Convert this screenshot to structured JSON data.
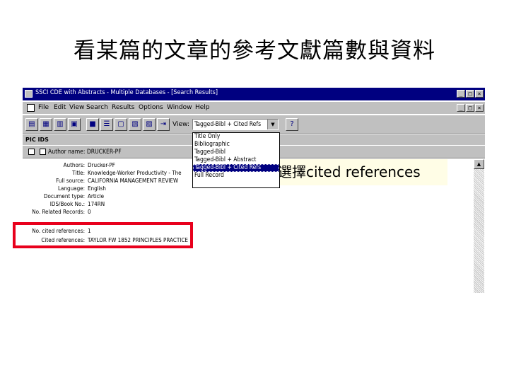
{
  "slide": {
    "title": "看某篇的文章的參考文獻篇數與資料"
  },
  "window": {
    "title": "SSCI CDE with Abstracts - Multiple Databases - [Search Results]",
    "controls": [
      "_",
      "□",
      "×"
    ],
    "doc_controls": [
      "_",
      "□",
      "×"
    ]
  },
  "menu": [
    "File",
    "Edit",
    "View",
    "Search",
    "Results",
    "Options",
    "Window",
    "Help"
  ],
  "toolbar": {
    "view_label": "View:",
    "view_value": "Tagged-Bibl + Cited Refs",
    "buttons": [
      "print-icon",
      "save-icon",
      "export-icon",
      "copy-icon",
      "mark-icon",
      "list-icon",
      "doc-icon",
      "related-icon",
      "cited-icon",
      "first-icon",
      "prev-icon",
      "next-icon",
      "last-icon"
    ],
    "help_glyph": "?"
  },
  "subbar": {
    "text": "PIC IDS"
  },
  "authbar": {
    "text": "Author name: DRUCKER-PF"
  },
  "dropdown": {
    "options": [
      "Title Only",
      "Bibliographic",
      "Tagged-Bibl",
      "Tagged-Bibl + Abstract",
      "Tagged-Bibl + Cited Refs",
      "Full Record"
    ],
    "selected_index": 4
  },
  "record": [
    {
      "label": "Authors:",
      "value": "Drucker-PF"
    },
    {
      "label": "Title:",
      "value": "Knowledge-Worker Productivity - The"
    },
    {
      "label": "Full source:",
      "value": "CALIFORNIA MANAGEMENT REVIEW"
    },
    {
      "label": "Language:",
      "value": "English"
    },
    {
      "label": "Document type:",
      "value": "Article"
    },
    {
      "label": "IDS/Book No.:",
      "value": "174RN"
    },
    {
      "label": "No. Related Records:",
      "value": "0"
    },
    {
      "label": "No. cited references:",
      "value": "1"
    },
    {
      "label": "Cited references:",
      "value": "TAYLOR FW 1852 PRINCIPLES PRACTICE"
    }
  ],
  "callout": {
    "text": "選擇cited references"
  },
  "colors": {
    "titlebar": "#000080",
    "chrome": "#c0c0c0",
    "highlight": "#e8001c",
    "callout_bg": "#fffde6"
  }
}
